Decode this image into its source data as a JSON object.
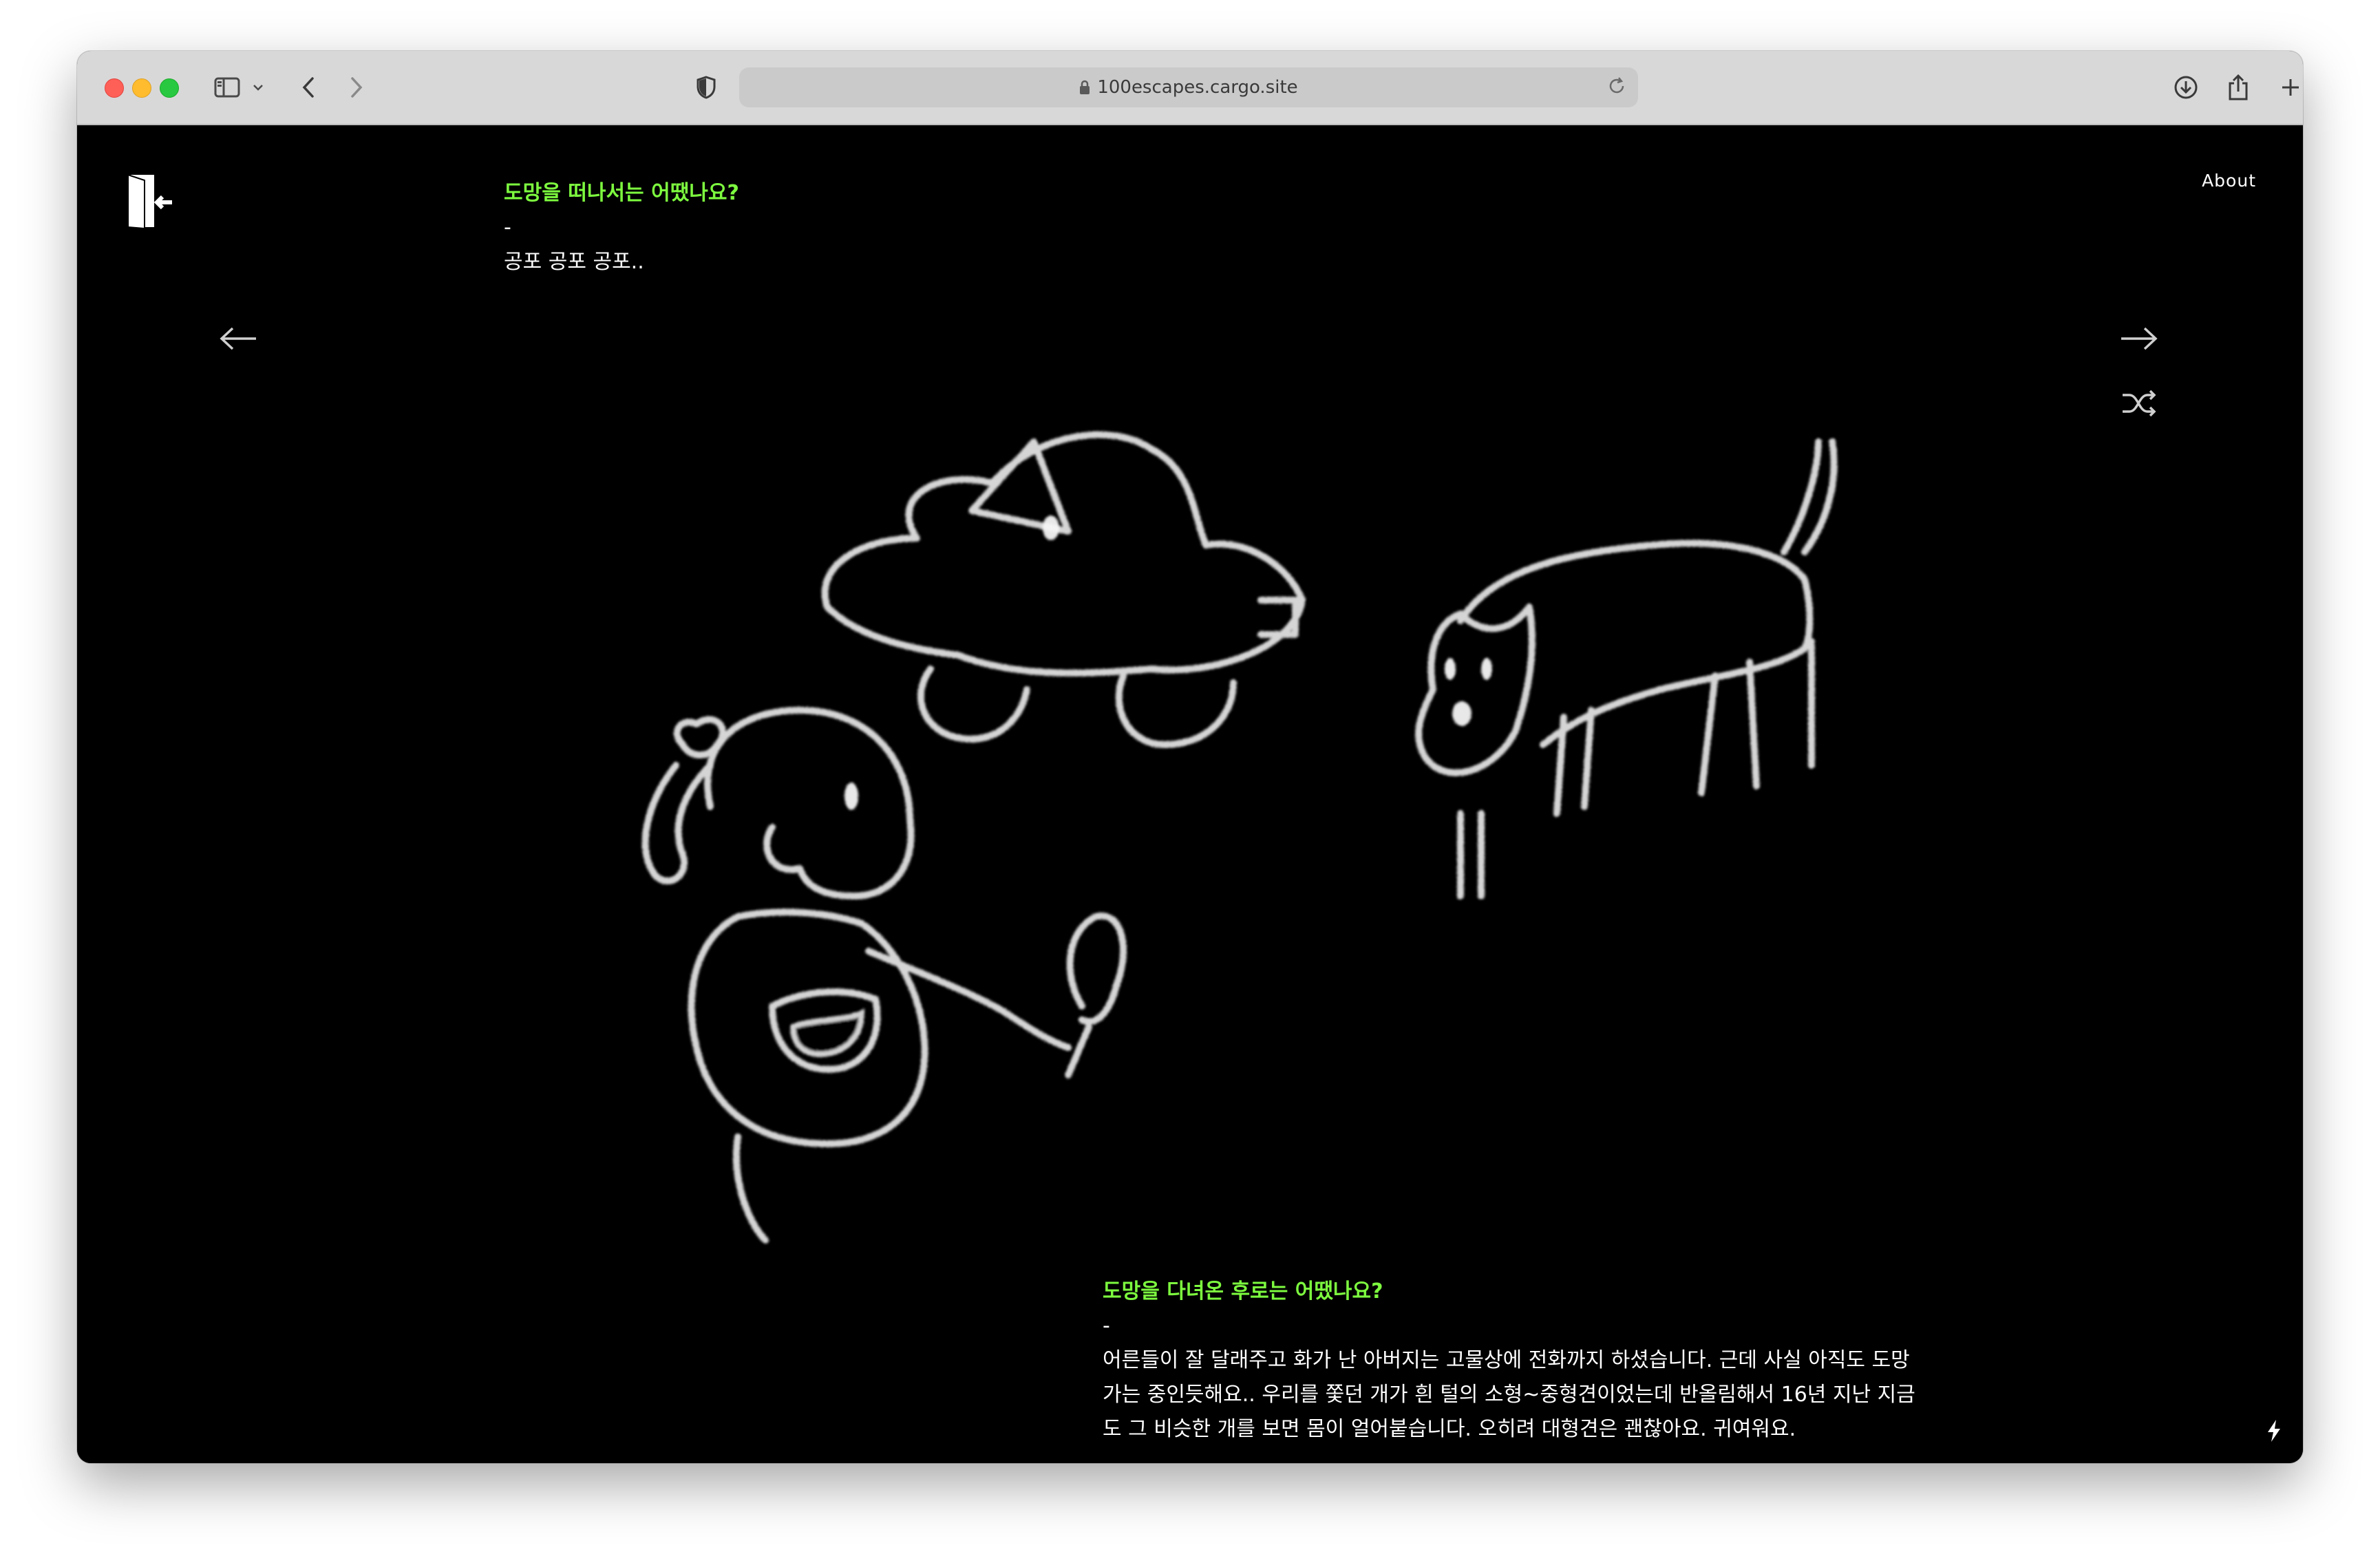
{
  "browser": {
    "url": "100escapes.cargo.site",
    "icons": [
      "sidebar-icon",
      "chevron-down-icon",
      "back-icon",
      "forward-icon",
      "shield-icon",
      "lock-icon",
      "reload-icon",
      "download-icon",
      "share-icon",
      "new-tab-icon",
      "tab-overview-icon"
    ]
  },
  "site": {
    "about_label": "About",
    "question1": {
      "title": "도망을 떠나서는 어땠나요?",
      "dash": "-",
      "answer": "공포 공포 공포.."
    },
    "question2": {
      "title": "도망을 다녀온 후로는 어땠나요?",
      "dash": "-",
      "answer": "어른들이 잘 달래주고 화가 난 아버지는 고물상에 전화까지 하셨습니다. 근데 사실 아직도 도망가는 중인듯해요.. 우리를 쫓던 개가 흰 털의 소형~중형견이었는데 반올림해서 16년 지난 지금도 그 비슷한 개를 보면 몸이 얼어붙습니다. 오히려 대형견은 괜찮아요. 귀여워요."
    },
    "icons": [
      "exit-door-logo-icon",
      "arrow-left-icon",
      "arrow-right-icon",
      "shuffle-icon",
      "lightning-icon"
    ],
    "colors": {
      "accent": "#7dfb3f",
      "background": "#000000",
      "text": "#ffffff"
    }
  }
}
